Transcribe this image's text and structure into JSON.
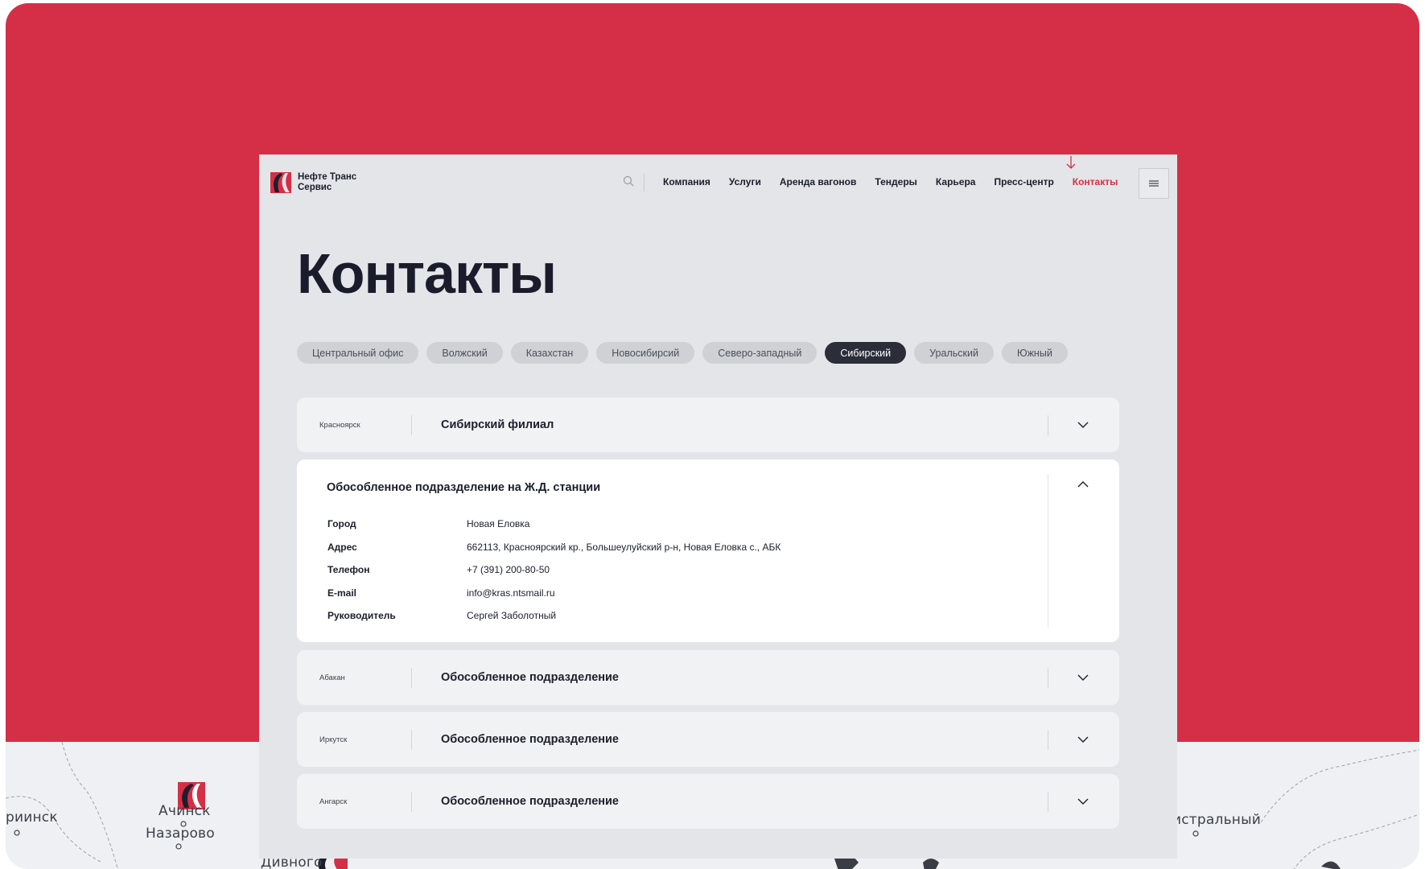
{
  "header": {
    "logo_text": "Нефте Транс Сервис",
    "nav": [
      {
        "label": "Компания",
        "active": false
      },
      {
        "label": "Услуги",
        "active": false
      },
      {
        "label": "Аренда вагонов",
        "active": false
      },
      {
        "label": "Тендеры",
        "active": false
      },
      {
        "label": "Карьера",
        "active": false
      },
      {
        "label": "Пресс-центр",
        "active": false
      },
      {
        "label": "Контакты",
        "active": true
      }
    ],
    "icons": [
      "logo-icon",
      "search-icon",
      "arrow-down-icon",
      "menu-icon"
    ]
  },
  "page_title": "Контакты",
  "tabs": [
    {
      "label": "Центральный офис",
      "active": false
    },
    {
      "label": "Волжский",
      "active": false
    },
    {
      "label": "Казахстан",
      "active": false
    },
    {
      "label": "Новосибирсий",
      "active": false
    },
    {
      "label": "Северо-западный",
      "active": false
    },
    {
      "label": "Сибирский",
      "active": true
    },
    {
      "label": "Уральский",
      "active": false
    },
    {
      "label": "Южный",
      "active": false
    }
  ],
  "branches": [
    {
      "city": "Красноярск",
      "name": "Сибирский филиал",
      "expanded": false
    },
    {
      "city": "",
      "name": "Обособленное подразделение на Ж.Д. станции",
      "expanded": true
    },
    {
      "city": "Абакан",
      "name": "Обособленное подразделение",
      "expanded": false
    },
    {
      "city": "Иркутск",
      "name": "Обособленное подразделение",
      "expanded": false
    },
    {
      "city": "Ангарск",
      "name": "Обособленное подразделение",
      "expanded": false
    }
  ],
  "details": {
    "rows": [
      {
        "label": "Город",
        "value": "Новая Еловка"
      },
      {
        "label": "Адрес",
        "value": "662113, Красноярский кр., Большеулуйский р-н, Новая Еловка с., АБК"
      },
      {
        "label": "Телефон",
        "value": "+7 (391) 200-80-50"
      },
      {
        "label": "E-mail",
        "value": "info@kras.ntsmail.ru"
      },
      {
        "label": "Руководитель",
        "value": "Сергей Заболотный"
      }
    ]
  },
  "map": {
    "labels": [
      "риинск",
      "Ачинск",
      "Назарово",
      "Дивного",
      "истральный"
    ]
  },
  "colors": {
    "brand_red": "#d42f46",
    "dark": "#2b2e39",
    "page_bg": "#e3e5e8"
  }
}
